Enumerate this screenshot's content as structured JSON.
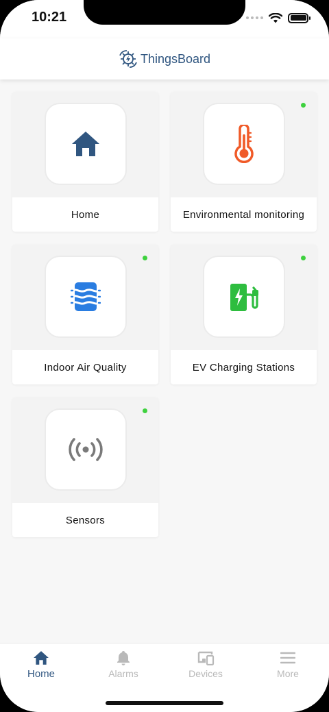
{
  "status_bar": {
    "time": "10:21"
  },
  "header": {
    "brand": "ThingsBoard",
    "logo_icon": "thingsboard-logo-icon"
  },
  "dashboards": [
    {
      "label": "Home",
      "icon": "home-icon",
      "icon_color": "#305680",
      "online": false
    },
    {
      "label": "Environmental monitoring",
      "icon": "thermometer-icon",
      "icon_color": "#f05a28",
      "online": true
    },
    {
      "label": "Indoor Air Quality",
      "icon": "air-quality-icon",
      "icon_color": "#2a7de1",
      "online": true
    },
    {
      "label": "EV Charging Stations",
      "icon": "ev-charger-icon",
      "icon_color": "#2ebd3f",
      "online": true
    },
    {
      "label": "Sensors",
      "icon": "sensor-icon",
      "icon_color": "#7a7a7a",
      "online": true
    }
  ],
  "colors": {
    "accent": "#305680",
    "online_dot": "#3ed13e",
    "inactive_nav": "#b9b9b9"
  },
  "bottom_nav": {
    "items": [
      {
        "label": "Home",
        "icon": "home-icon",
        "active": true
      },
      {
        "label": "Alarms",
        "icon": "bell-icon",
        "active": false
      },
      {
        "label": "Devices",
        "icon": "devices-icon",
        "active": false
      },
      {
        "label": "More",
        "icon": "menu-icon",
        "active": false
      }
    ]
  }
}
